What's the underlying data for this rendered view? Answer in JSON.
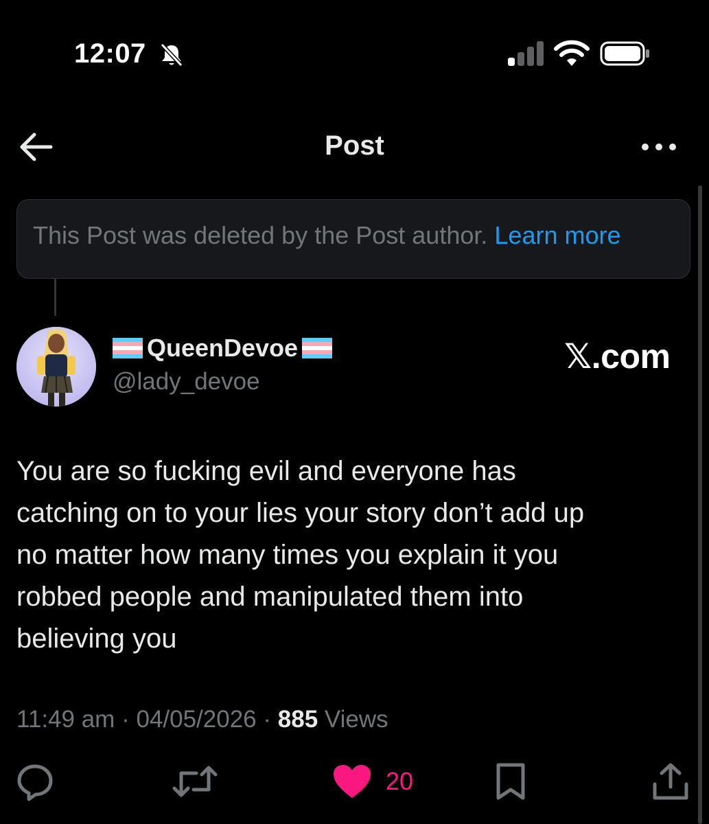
{
  "status_bar": {
    "time": "12:07",
    "icons": [
      "bell-slash-icon",
      "cellular-signal-icon",
      "wifi-icon",
      "battery-icon"
    ]
  },
  "header": {
    "title": "Post",
    "back_icon": "arrow-left-icon",
    "more_icon": "ellipsis-icon"
  },
  "deleted_notice": {
    "text": "This Post was deleted by the Post author.",
    "link": "Learn more"
  },
  "author": {
    "display_name": "QueenDevoe",
    "handle": "@lady_devoe",
    "name_emoji": "transgender-flag-icon"
  },
  "watermark": "𝕏.com",
  "post": {
    "lines": [
      "You are so fucking evil and everyone has",
      "catching on to your lies your story don’t add up",
      "no matter how many times you explain it you",
      "robbed people and manipulated them into",
      "believing you"
    ]
  },
  "meta": {
    "time": "11:49 am",
    "date": "04/05/2026",
    "views_count": "885",
    "views_label": "Views",
    "separator": "·"
  },
  "actions": {
    "like_count": "20",
    "icons": [
      "reply-icon",
      "repost-icon",
      "heart-filled-icon",
      "bookmark-icon",
      "share-icon"
    ]
  },
  "colors": {
    "background": "#000000",
    "text": "#e7e9ea",
    "muted": "#71767b",
    "link": "#1d9bf0",
    "like": "#f91880"
  }
}
